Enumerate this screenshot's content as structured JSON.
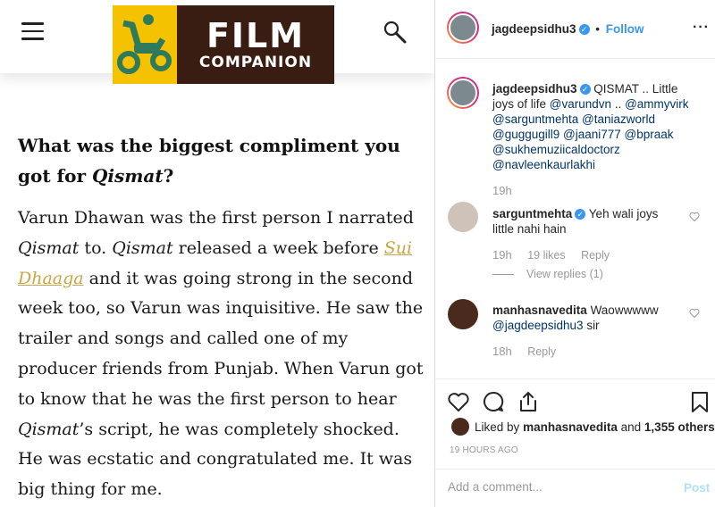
{
  "article": {
    "logo": {
      "line1": "FILM",
      "line2": "COMPANION"
    },
    "question_pre": "What was the biggest compliment you got for ",
    "question_em": "Qismat",
    "question_post": "?",
    "answer": {
      "p1": "Varun Dhawan was the first person I narrated ",
      "em1": "Qismat",
      "p2": " to. ",
      "em2": "Qismat",
      "p3": " released a week before ",
      "link": "Sui Dhaaga",
      "p4": " and it was going strong in the second week too, so Varun was inquisitive. He saw the trailer and songs and called one of my producer friends from Punjab. When Varun got to know that he was the first person to hear ",
      "em3": "Qismat",
      "p5": "’s script, he was completely shocked. He was ecstatic and congratulated me. It was big thing for me."
    }
  },
  "post": {
    "header": {
      "username": "jagdeepsidhu3",
      "separator": "•",
      "follow": "Follow",
      "more": "···"
    },
    "caption": {
      "username": "jagdeepsidhu3",
      "text": "QISMAT .. Little joys of life",
      "mentions1": "@varundvn",
      "mid": "..",
      "mentions2": "@ammyvirk",
      "line_rest": "@sarguntmehta @taniazworld @guggugill9 @jaani777 @bpraak @sukhemuziicaldoctorz @navleenkaurlakhi",
      "time": "19h"
    },
    "comments": [
      {
        "username": "sarguntmehta",
        "text": "Yeh wali joys little nahi hain",
        "time": "19h",
        "likes": "19 likes",
        "reply": "Reply",
        "view_replies": "View replies (1)"
      },
      {
        "username": "manhasnavedita",
        "text": "Waowwwww",
        "mention": "@jagdeepsidhu3",
        "suffix": "sir",
        "time": "18h",
        "reply": "Reply"
      }
    ],
    "likes": {
      "prefix": "Liked by",
      "user": "manhasnavedita",
      "and": "and",
      "others": "1,355 others"
    },
    "time_ago": "19 HOURS AGO",
    "comment_placeholder": "Add a comment...",
    "post_label": "Post"
  }
}
